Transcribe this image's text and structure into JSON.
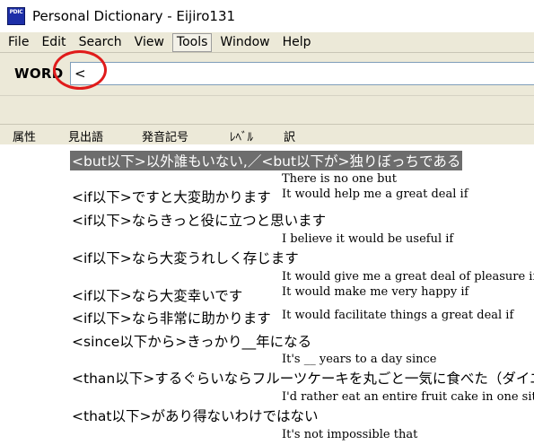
{
  "window": {
    "icon_text": "PDIC",
    "title": "Personal Dictionary - Eijiro131"
  },
  "menu": {
    "items": [
      {
        "id": "file",
        "label": "File"
      },
      {
        "id": "edit",
        "label": "Edit"
      },
      {
        "id": "search",
        "label": "Search"
      },
      {
        "id": "view",
        "label": "View"
      },
      {
        "id": "tools",
        "label": "Tools",
        "active": true
      },
      {
        "id": "window",
        "label": "Window"
      },
      {
        "id": "help",
        "label": "Help"
      }
    ]
  },
  "search": {
    "label": "WORD",
    "value": "<"
  },
  "columns": {
    "attribute": "属性",
    "headword": "見出語",
    "pronunciation": "発音記号",
    "level": "ﾚﾍﾞﾙ",
    "translation": "訳"
  },
  "results": [
    {
      "headword": "<but以下>以外誰もいない,／<but以下が>独りぼっちである",
      "translation": "There is no one but",
      "selected": true
    },
    {
      "headword": "<if以下>ですと大変助かります",
      "translation": "It would help me a great deal if"
    },
    {
      "headword": "<if以下>ならきっと役に立つと思います",
      "translation": "I believe it would be useful if"
    },
    {
      "headword": "<if以下>なら大変うれしく存じます",
      "translation": "It would give me a great deal of pleasure if"
    },
    {
      "headword": "<if以下>なら大変幸いです",
      "translation": "It would make me very happy if"
    },
    {
      "headword": "<if以下>なら非常に助かります",
      "translation": "It would facilitate things a great deal if"
    },
    {
      "headword": "<since以下から>きっかり__年になる",
      "translation": "It's __ years to a day since"
    },
    {
      "headword": "<than以下>するぐらいならフルーツケーキを丸ごと一気に食べた（ダイエ",
      "translation": "I'd rather eat an entire fruit cake in one sitt"
    },
    {
      "headword": "<that以下>があり得ないわけではない",
      "translation": "It's not impossible that"
    }
  ],
  "colors": {
    "annotation_circle": "#e01b1b",
    "selection": "#6d6d6d",
    "window_bg": "#ece9d8"
  }
}
